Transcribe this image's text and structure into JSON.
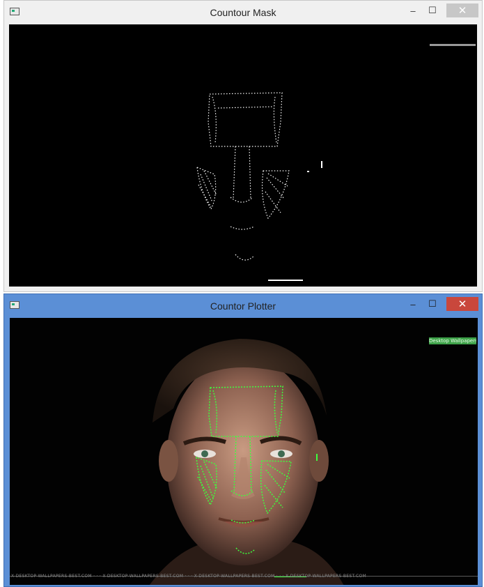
{
  "windows": [
    {
      "title": "Countour Mask",
      "controls": {
        "minimize": "–",
        "maximize": "☐",
        "close": "✕"
      }
    },
    {
      "title": "Countor Plotter",
      "controls": {
        "minimize": "–",
        "maximize": "☐",
        "close": "✕"
      },
      "watermark_badge": "Desktop Wallpapers.Com",
      "footer_watermark": "X-DESKTOP-WALLPAPERS-BEST.COM · · · X-DESKTOP-WALLPAPERS-BEST.COM · · · X-DESKTOP-WALLPAPERS-BEST.COM · · · X-DESKTOP-WALLPAPERS-BEST.COM"
    }
  ],
  "colors": {
    "contour_overlay": "#3dff3d",
    "mask_contour": "#ffffff",
    "active_title_bar": "#5b8fd6",
    "inactive_title_bar": "#f0f0f0"
  }
}
